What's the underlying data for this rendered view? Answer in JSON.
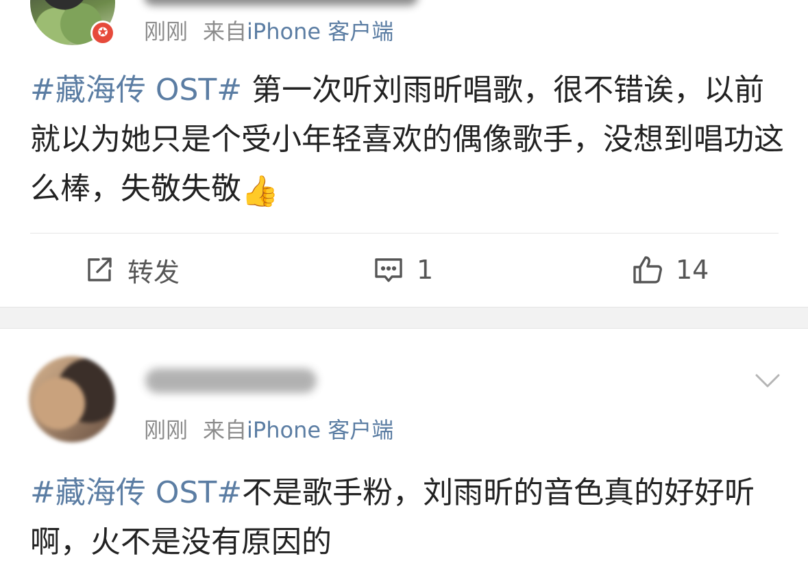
{
  "post1": {
    "time": "刚刚",
    "from_label": "来自",
    "source": "iPhone 客户端",
    "hashtag": "#藏海传 OST#",
    "body": " 第一次听刘雨昕唱歌，很不错诶，以前就以为她只是个受小年轻喜欢的偶像歌手，没想到唱功这么棒，失敬失敬",
    "emoji": "👍",
    "actions": {
      "repost_label": "转发",
      "comment_count": "1",
      "like_count": "14"
    }
  },
  "post2": {
    "time": "刚刚",
    "from_label": "来自",
    "source": "iPhone 客户端",
    "hashtag": "#藏海传 OST#",
    "body": "不是歌手粉，刘雨昕的音色真的好好听啊，火不是没有原因的"
  },
  "colors": {
    "link": "#5b7da3",
    "meta_gray": "#8c8c8c",
    "badge_red": "#e64a3b",
    "separator": "#f2f2f2"
  },
  "icons": {
    "repost": "share-square-icon",
    "comment": "comment-bubble-icon",
    "like": "thumbs-up-icon",
    "menu": "chevron-down-icon",
    "badge": "verified-badge-icon"
  }
}
